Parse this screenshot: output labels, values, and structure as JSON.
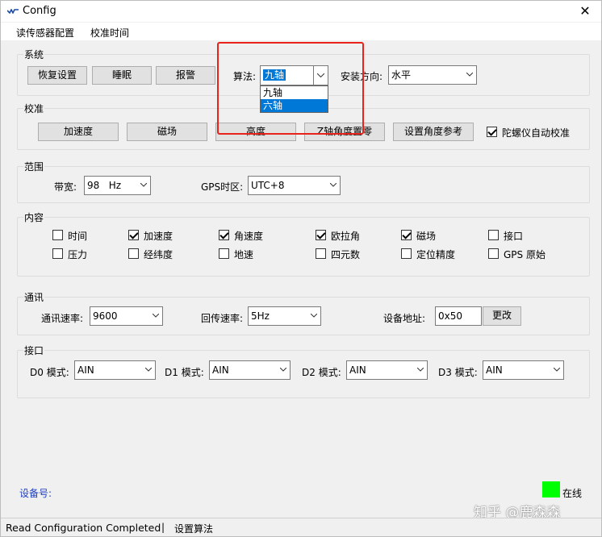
{
  "window": {
    "title": "Config",
    "close_glyph": "✕"
  },
  "menu": {
    "items": [
      {
        "label": "读传感器配置"
      },
      {
        "label": "校准时间"
      }
    ]
  },
  "system": {
    "label": "系统",
    "buttons": [
      "恢复设置",
      "睡眠",
      "报警"
    ],
    "algorithm_label": "算法:",
    "algorithm_value": "九轴",
    "algorithm_options": [
      "九轴",
      "六轴"
    ],
    "install_label": "安装方向:",
    "install_value": "水平"
  },
  "calibration": {
    "label": "校准",
    "buttons": [
      "加速度",
      "磁场",
      "高度",
      "Z轴角度置零",
      "设置角度参考"
    ],
    "gyro_auto_label": "陀螺仪自动校准",
    "gyro_auto_checked": true
  },
  "range": {
    "label": "范围",
    "bandwidth_label": "带宽:",
    "bandwidth_value": "98   Hz",
    "gps_tz_label": "GPS时区:",
    "gps_tz_value": "UTC+8"
  },
  "content": {
    "label": "内容",
    "items": [
      {
        "label": "时间",
        "checked": false
      },
      {
        "label": "加速度",
        "checked": true
      },
      {
        "label": "角速度",
        "checked": true
      },
      {
        "label": "欧拉角",
        "checked": true
      },
      {
        "label": "磁场",
        "checked": true
      },
      {
        "label": "接口",
        "checked": false
      },
      {
        "label": "压力",
        "checked": false
      },
      {
        "label": "经纬度",
        "checked": false
      },
      {
        "label": "地速",
        "checked": false
      },
      {
        "label": "四元数",
        "checked": false
      },
      {
        "label": "定位精度",
        "checked": false
      },
      {
        "label": "GPS 原始",
        "checked": false
      }
    ]
  },
  "comm": {
    "label": "通讯",
    "baud_label": "通讯速率:",
    "baud_value": "9600",
    "return_label": "回传速率:",
    "return_value": "5Hz",
    "addr_label": "设备地址:",
    "addr_value": "0x50",
    "change_label": "更改"
  },
  "ports": {
    "label": "接口",
    "items": [
      {
        "label": "D0 模式:",
        "value": "AIN"
      },
      {
        "label": "D1 模式:",
        "value": "AIN"
      },
      {
        "label": "D2 模式:",
        "value": "AIN"
      },
      {
        "label": "D3 模式:",
        "value": "AIN"
      }
    ]
  },
  "device": {
    "label": "设备号:",
    "online_label": "在线",
    "online_color": "#00ff00"
  },
  "status": {
    "message": "Read Configuration Completed",
    "separator": "|",
    "action": "设置算法"
  },
  "watermark": "知乎 @鹿森森",
  "colors": {
    "accent": "#0078d7",
    "highlight_box": "#e8231c",
    "device_label": "#1f3fbf"
  }
}
